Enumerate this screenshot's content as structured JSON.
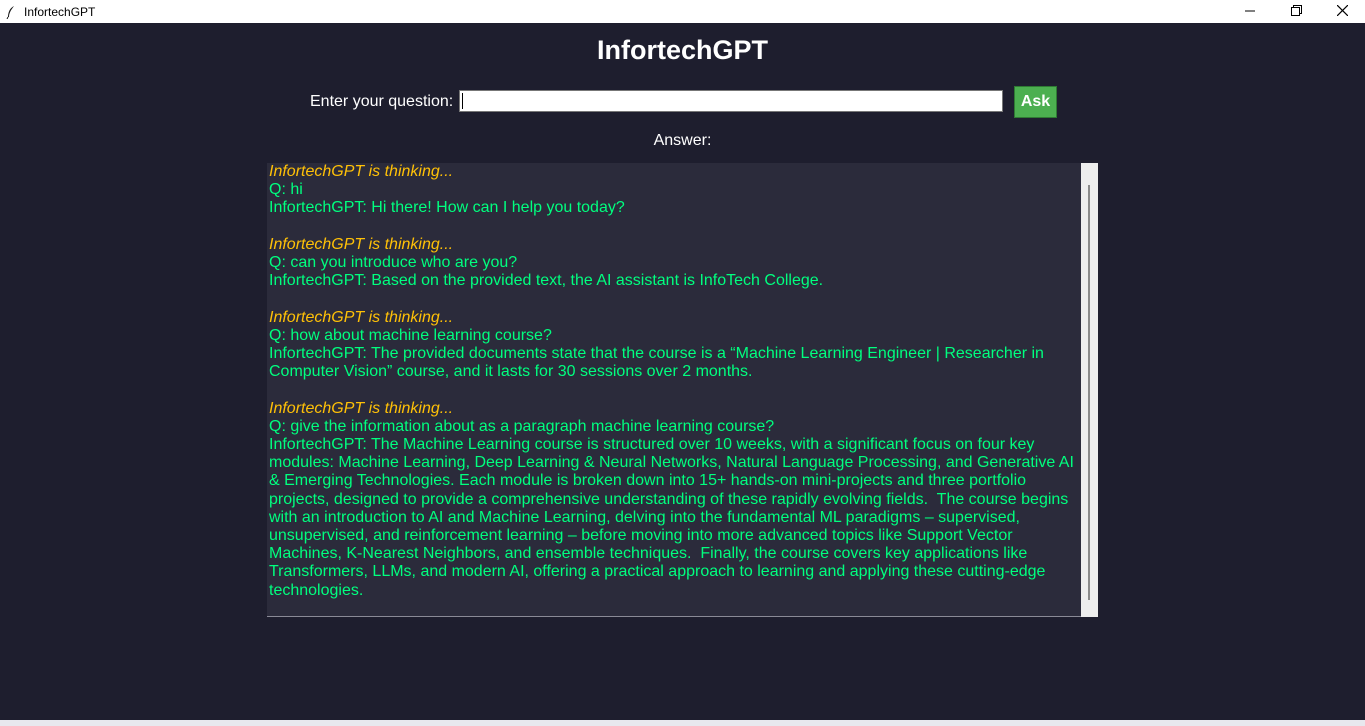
{
  "window": {
    "title": "InfortechGPT"
  },
  "header": {
    "title": "InfortechGPT"
  },
  "question": {
    "label": "Enter your question:",
    "value": "",
    "ask_label": "Ask"
  },
  "answer": {
    "label": "Answer:",
    "blocks": [
      {
        "thinking": "InfortechGPT is thinking...",
        "question": "Q: hi",
        "response": "InfortechGPT: Hi there! How can I help you today?"
      },
      {
        "thinking": "InfortechGPT is thinking...",
        "question": "Q: can you introduce who are you?",
        "response": "InfortechGPT: Based on the provided text, the AI assistant is InfoTech College."
      },
      {
        "thinking": "InfortechGPT is thinking...",
        "question": "Q: how about machine learning course?",
        "response": "InfortechGPT: The provided documents state that the course is a “Machine Learning Engineer | Researcher in Computer Vision” course, and it lasts for 30 sessions over 2 months."
      },
      {
        "thinking": "InfortechGPT is thinking...",
        "question": "Q: give the information about as a paragraph machine learning course?",
        "response": "InfortechGPT: The Machine Learning course is structured over 10 weeks, with a significant focus on four key modules: Machine Learning, Deep Learning & Neural Networks, Natural Language Processing, and Generative AI & Emerging Technologies. Each module is broken down into 15+ hands-on mini-projects and three portfolio projects, designed to provide a comprehensive understanding of these rapidly evolving fields.  The course begins with an introduction to AI and Machine Learning, delving into the fundamental ML paradigms – supervised, unsupervised, and reinforcement learning – before moving into more advanced topics like Support Vector Machines, K-Nearest Neighbors, and ensemble techniques.  Finally, the course covers key applications like Transformers, LLMs, and modern AI, offering a practical approach to learning and applying these cutting-edge technologies."
      }
    ]
  },
  "colors": {
    "background": "#1e1e2e",
    "panel": "#2b2b3b",
    "thinking": "#ffc107",
    "text": "#00ff7f",
    "button": "#4caf50"
  },
  "icons": {
    "app": "feather-icon",
    "minimize": "minimize-icon",
    "maximize": "restore-icon",
    "close": "close-icon"
  }
}
